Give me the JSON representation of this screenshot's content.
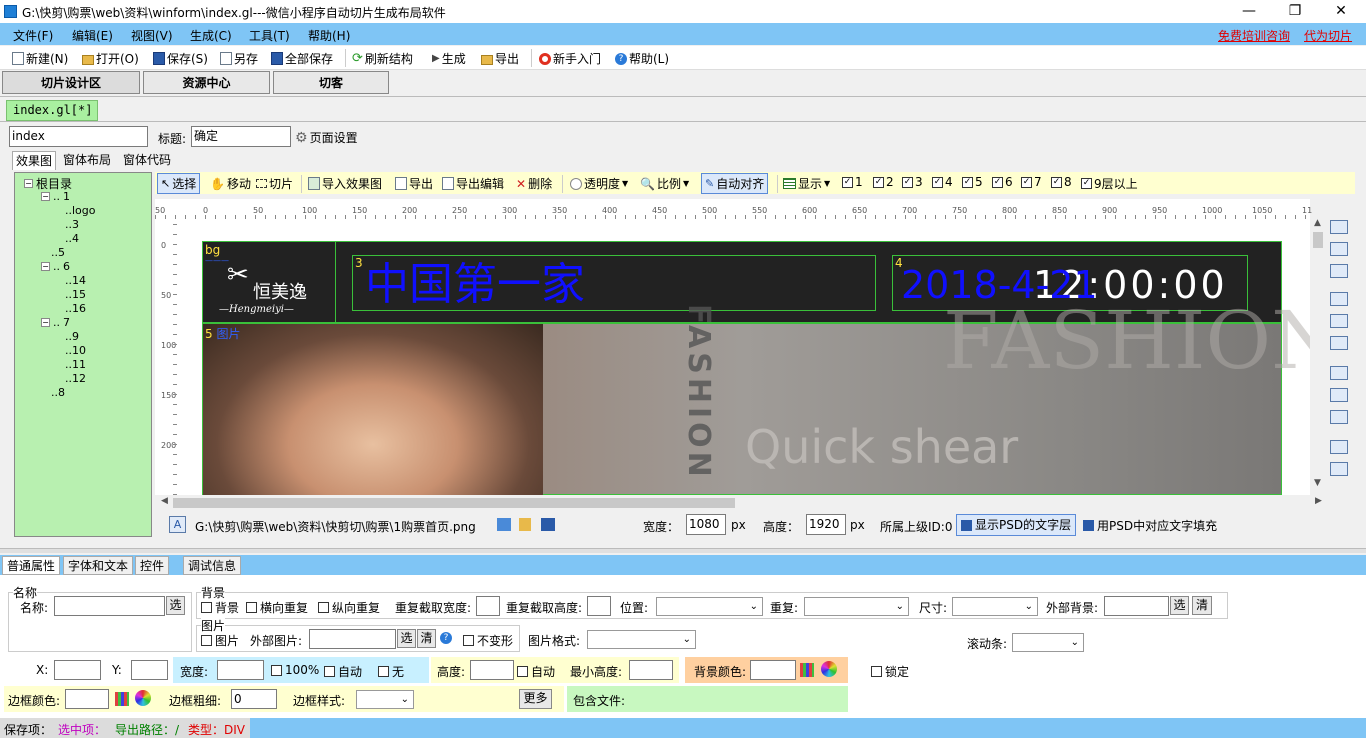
{
  "window": {
    "title": "G:\\快剪\\购票\\web\\资料\\winform\\index.gl---微信小程序自动切片生成布局软件",
    "min": "—",
    "max": "❐",
    "close": "✕"
  },
  "menu": {
    "items": [
      "文件(F)",
      "编辑(E)",
      "视图(V)",
      "生成(C)",
      "工具(T)",
      "帮助(H)"
    ],
    "links": [
      "免费培训咨询",
      "代为切片"
    ]
  },
  "toolbar": {
    "new": "新建(N)",
    "open": "打开(O)",
    "save": "保存(S)",
    "save_as": "另存",
    "save_all": "全部保存",
    "refresh": "刷新结构",
    "generate": "生成",
    "export": "导出",
    "beginner": "新手入门",
    "help": "帮助(L)"
  },
  "main_tabs": [
    "切片设计区",
    "资源中心",
    "切客"
  ],
  "file_tab": "index.gl[*]",
  "page": {
    "name_value": "index",
    "title_label": "标题:",
    "title_value": "确定",
    "settings": "页面设置"
  },
  "sub_tabs": [
    "效果图",
    "窗体布局",
    "窗体代码"
  ],
  "tree": {
    "root": "根目录",
    "n1": "1",
    "logo": "logo",
    "n3": "3",
    "n4": "4",
    "n5": "5",
    "n6": "6",
    "n14": "14",
    "n15": "15",
    "n16": "16",
    "n7": "7",
    "n9": "9",
    "n10": "10",
    "n11": "11",
    "n12": "12",
    "n8": "8"
  },
  "design_toolbar": {
    "select": "选择",
    "move": "移动",
    "slice": "切片",
    "import": "导入效果图",
    "export": "导出",
    "export_edit": "导出编辑",
    "delete": "删除",
    "opacity": "透明度",
    "ratio": "比例",
    "auto_align": "自动对齐",
    "show": "显示",
    "layers": [
      "1",
      "2",
      "3",
      "4",
      "5",
      "6",
      "7",
      "8",
      "9层以上"
    ]
  },
  "ruler_h": [
    "50",
    "0",
    "50",
    "100",
    "150",
    "200",
    "250",
    "300",
    "350",
    "400",
    "450",
    "500",
    "550",
    "600",
    "650",
    "700",
    "750",
    "800",
    "850",
    "900",
    "950",
    "1000",
    "1050",
    "11"
  ],
  "ruler_v": [
    "0",
    "50",
    "100",
    "150",
    "200"
  ],
  "canvas": {
    "label_bg": "bg",
    "logo_cn": "恒美逸",
    "logo_en": "—Hengmeiyi—",
    "label_3": "3",
    "text_3": "中国第一家",
    "label_4": "4",
    "text_4": "2018-4-21",
    "time": "12:00:00",
    "label_5": "5",
    "label_5_suffix": "图片",
    "fashion_vertical": "FASHION",
    "fashion_big": "FASHION",
    "quick_shear": "Quick shear"
  },
  "file_status": {
    "path": "G:\\快剪\\购票\\web\\资料\\快剪切\\购票\\1购票首页.png",
    "width_label": "宽度：",
    "width_value": "1080",
    "height_label": "高度：",
    "height_value": "1920",
    "px": "px",
    "parent_id": "所属上级ID:0",
    "show_psd_text": "显示PSD的文字层",
    "fill_psd_text": "用PSD中对应文字填充"
  },
  "bottom_tabs": [
    "普通属性",
    "字体和文本",
    "控件",
    "调试信息"
  ],
  "props": {
    "name_group": "名称",
    "name_label": "名称:",
    "choose": "选",
    "clear": "清",
    "bg_group": "背景",
    "bg_check": "背景",
    "repeat_x": "横向重复",
    "repeat_y": "纵向重复",
    "crop_w": "重复截取宽度:",
    "crop_h": "重复截取高度:",
    "position": "位置:",
    "repeat": "重复:",
    "size": "尺寸:",
    "outer_bg": "外部背景:",
    "img_group": "图片",
    "img_check": "图片",
    "outer_img": "外部图片:",
    "no_deform": "不变形",
    "img_format": "图片格式:",
    "scrollbar": "滚动条:",
    "x": "X:",
    "y": "Y:",
    "width": "宽度:",
    "pct100": "100%",
    "auto": "自动",
    "none": "无",
    "height": "高度:",
    "auto2": "自动",
    "min_height": "最小高度:",
    "bg_color": "背景颜色:",
    "lock": "锁定",
    "border_color": "边框颜色:",
    "border_width": "边框粗细:",
    "border_width_value": "0",
    "border_style": "边框样式:",
    "more": "更多",
    "include_file": "包含文件:"
  },
  "statusbar": {
    "saved": "保存项：",
    "selected": "选中项：",
    "export_path": "导出路径：/",
    "type": "类型：DIV"
  }
}
